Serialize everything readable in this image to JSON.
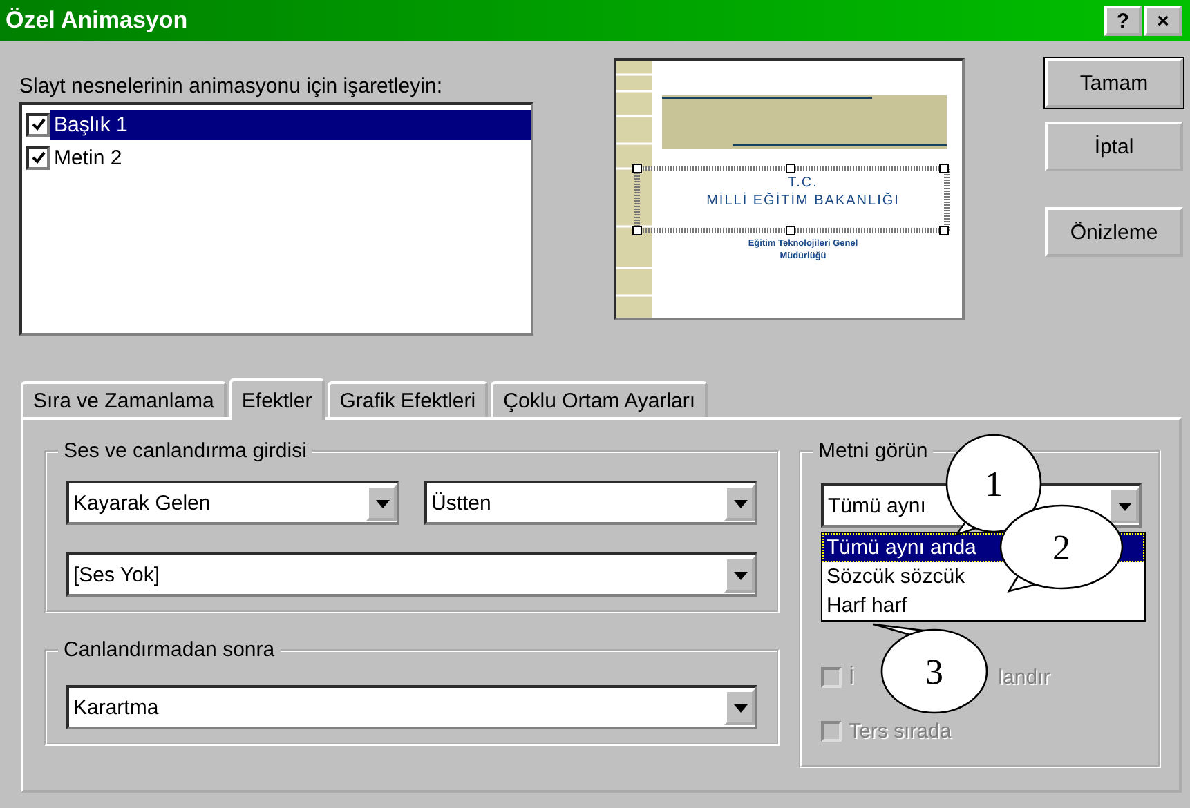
{
  "window": {
    "title": "Özel Animasyon",
    "buttons": [
      "?",
      "×"
    ]
  },
  "objects_label": "Slayt nesnelerinin animasyonu için işaretleyin:",
  "objects": [
    {
      "label": "Başlık 1",
      "checked": true,
      "selected": true
    },
    {
      "label": "Metin 2",
      "checked": true,
      "selected": false
    }
  ],
  "preview": {
    "kind": "slide",
    "title_lines": [
      "T.C.",
      "MİLLİ EĞİTİM BAKANLIĞI"
    ],
    "subtitle": "Eğitim Teknolojileri Genel Müdürlüğü"
  },
  "buttons": [
    {
      "label": "Tamam",
      "default": true
    },
    {
      "label": "İptal",
      "default": false
    },
    {
      "label": "Önizleme",
      "default": false
    }
  ],
  "tabs": [
    {
      "label": "Sıra ve Zamanlama",
      "selected": false
    },
    {
      "label": "Efektler",
      "selected": true
    },
    {
      "label": "Grafik Efektleri",
      "selected": false
    },
    {
      "label": "Çoklu Ortam Ayarları",
      "selected": false
    }
  ],
  "entry_group": {
    "title": "Ses ve canlandırma girdisi",
    "effect": "Kayarak Gelen",
    "direction": "Üstten",
    "sound": "[Ses Yok]"
  },
  "after_group": {
    "title": "Canlandırmadan sonra",
    "value": "Karartma"
  },
  "text_group": {
    "title": "Metni görün",
    "value": "Tümü aynı",
    "dropdown": [
      {
        "label": "Tümü aynı anda",
        "selected": true
      },
      {
        "label": "Sözcük sözcük",
        "selected": false
      },
      {
        "label": "Harf harf",
        "selected": false
      }
    ],
    "checkboxes": [
      {
        "label_parts": [
          "İ",
          "landır"
        ],
        "checked": false,
        "disabled": true
      },
      {
        "label_parts": [
          "Ters sırada"
        ],
        "checked": false,
        "disabled": true
      }
    ]
  },
  "callouts": [
    {
      "label": "1"
    },
    {
      "label": "2"
    },
    {
      "label": "3"
    }
  ]
}
